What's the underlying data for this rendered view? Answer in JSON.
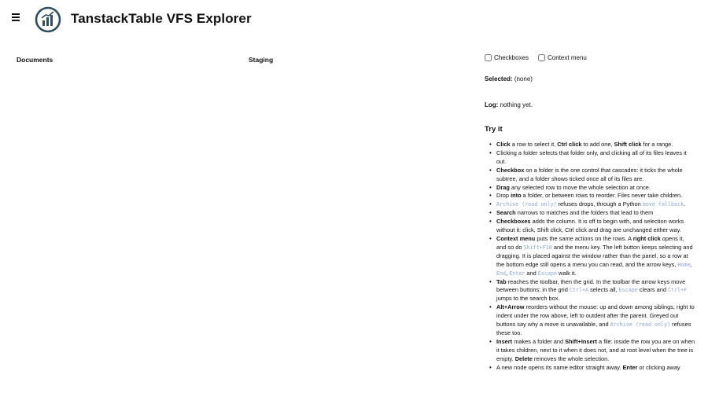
{
  "header": {
    "title": "TanstackTable VFS Explorer",
    "menu_icon": "hamburger-menu-icon",
    "logo_icon": "chart-logo-icon",
    "accent": "#2f4f5f"
  },
  "panels": {
    "documents": "Documents",
    "staging": "Staging"
  },
  "options": {
    "checkboxes_label": "Checkboxes",
    "context_menu_label": "Context menu",
    "checkboxes_checked": false,
    "context_menu_checked": false
  },
  "status": {
    "selected_label": "Selected:",
    "selected_value": "(none)",
    "log_label": "Log:",
    "log_value": "nothing yet."
  },
  "help": {
    "title": "Try it",
    "tips": [
      [
        {
          "t": "Click",
          "b": true
        },
        {
          "t": " a row to select it, "
        },
        {
          "t": "Ctrl click",
          "b": true
        },
        {
          "t": " to add one, "
        },
        {
          "t": "Shift click",
          "b": true
        },
        {
          "t": " for a range."
        }
      ],
      [
        {
          "t": "Clicking a folder selects that folder only, and clicking all of its files leaves it out."
        }
      ],
      [
        {
          "t": "Checkbox",
          "b": true
        },
        {
          "t": " on a folder is the one control that cascades: it ticks the whole subtree, and a folder shows ticked once all of its files are."
        }
      ],
      [
        {
          "t": "Drag",
          "b": true
        },
        {
          "t": " any selected row to move the whole selection at once."
        }
      ],
      [
        {
          "t": "Drop "
        },
        {
          "t": "into",
          "b": true
        },
        {
          "t": " a folder, or between rows to reorder. Files never take children."
        }
      ],
      [
        {
          "t": "Archive (read only)",
          "c": true
        },
        {
          "t": " refuses drops, through a Python "
        },
        {
          "t": "move fallback",
          "c": true
        },
        {
          "t": "."
        }
      ],
      [
        {
          "t": "Search",
          "b": true
        },
        {
          "t": " narrows to matches and the folders that lead to them"
        }
      ],
      [
        {
          "t": "Checkboxes",
          "b": true
        },
        {
          "t": " adds the column. It is off to begin with, and selection works without it: click, Shift click, Ctrl click and drag are unchanged either way."
        }
      ],
      [
        {
          "t": "Context menu",
          "b": true
        },
        {
          "t": " puts the same actions on the rows. A "
        },
        {
          "t": "right click",
          "b": true
        },
        {
          "t": " opens it, and so do "
        },
        {
          "t": "Shift+F10",
          "c": true
        },
        {
          "t": " and the menu key. The left button keeps selecting and dragging. It is placed against the window rather than the panel, so a row at the bottom edge still opens a menu you can read, and the arrow keys, "
        },
        {
          "t": "Home",
          "c": true
        },
        {
          "t": ", "
        },
        {
          "t": "End",
          "c": true
        },
        {
          "t": ", "
        },
        {
          "t": "Enter",
          "c": true
        },
        {
          "t": " and "
        },
        {
          "t": "Escape",
          "c": true
        },
        {
          "t": " walk it."
        }
      ],
      [
        {
          "t": "Tab",
          "b": true
        },
        {
          "t": " reaches the toolbar, then the grid. In the toolbar the arrow keys move between buttons; in the grid "
        },
        {
          "t": "Ctrl+A",
          "c": true
        },
        {
          "t": " selects all, "
        },
        {
          "t": "Escape",
          "c": true
        },
        {
          "t": " clears and "
        },
        {
          "t": "Ctrl+F",
          "c": true
        },
        {
          "t": " jumps to the search box."
        }
      ],
      [
        {
          "t": "Alt+Arrow",
          "b": true
        },
        {
          "t": " reorders without the mouse: up and down among siblings, right to indent under the row above, left to outdent after the parent. Greyed out buttons say why a move is unavailable, and "
        },
        {
          "t": "Archive (read only)",
          "c": true
        },
        {
          "t": " refuses these too."
        }
      ],
      [
        {
          "t": "Insert",
          "b": true
        },
        {
          "t": " makes a folder and "
        },
        {
          "t": "Shift+Insert",
          "b": true
        },
        {
          "t": " a file: inside the row you are on when it takes children, next to it when it does not, and at root level when the tree is empty. "
        },
        {
          "t": "Delete",
          "b": true
        },
        {
          "t": " removes the whole selection."
        }
      ],
      [
        {
          "t": "A new node opens its name editor straight away. "
        },
        {
          "t": "Enter",
          "b": true
        },
        {
          "t": " or clicking away"
        }
      ]
    ]
  }
}
